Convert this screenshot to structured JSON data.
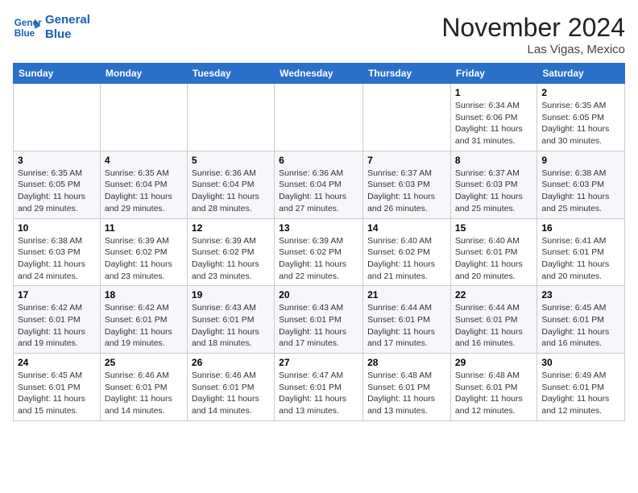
{
  "header": {
    "logo_line1": "General",
    "logo_line2": "Blue",
    "month_title": "November 2024",
    "location": "Las Vigas, Mexico"
  },
  "weekdays": [
    "Sunday",
    "Monday",
    "Tuesday",
    "Wednesday",
    "Thursday",
    "Friday",
    "Saturday"
  ],
  "weeks": [
    [
      {
        "day": "",
        "info": ""
      },
      {
        "day": "",
        "info": ""
      },
      {
        "day": "",
        "info": ""
      },
      {
        "day": "",
        "info": ""
      },
      {
        "day": "",
        "info": ""
      },
      {
        "day": "1",
        "info": "Sunrise: 6:34 AM\nSunset: 6:06 PM\nDaylight: 11 hours and 31 minutes."
      },
      {
        "day": "2",
        "info": "Sunrise: 6:35 AM\nSunset: 6:05 PM\nDaylight: 11 hours and 30 minutes."
      }
    ],
    [
      {
        "day": "3",
        "info": "Sunrise: 6:35 AM\nSunset: 6:05 PM\nDaylight: 11 hours and 29 minutes."
      },
      {
        "day": "4",
        "info": "Sunrise: 6:35 AM\nSunset: 6:04 PM\nDaylight: 11 hours and 29 minutes."
      },
      {
        "day": "5",
        "info": "Sunrise: 6:36 AM\nSunset: 6:04 PM\nDaylight: 11 hours and 28 minutes."
      },
      {
        "day": "6",
        "info": "Sunrise: 6:36 AM\nSunset: 6:04 PM\nDaylight: 11 hours and 27 minutes."
      },
      {
        "day": "7",
        "info": "Sunrise: 6:37 AM\nSunset: 6:03 PM\nDaylight: 11 hours and 26 minutes."
      },
      {
        "day": "8",
        "info": "Sunrise: 6:37 AM\nSunset: 6:03 PM\nDaylight: 11 hours and 25 minutes."
      },
      {
        "day": "9",
        "info": "Sunrise: 6:38 AM\nSunset: 6:03 PM\nDaylight: 11 hours and 25 minutes."
      }
    ],
    [
      {
        "day": "10",
        "info": "Sunrise: 6:38 AM\nSunset: 6:03 PM\nDaylight: 11 hours and 24 minutes."
      },
      {
        "day": "11",
        "info": "Sunrise: 6:39 AM\nSunset: 6:02 PM\nDaylight: 11 hours and 23 minutes."
      },
      {
        "day": "12",
        "info": "Sunrise: 6:39 AM\nSunset: 6:02 PM\nDaylight: 11 hours and 23 minutes."
      },
      {
        "day": "13",
        "info": "Sunrise: 6:39 AM\nSunset: 6:02 PM\nDaylight: 11 hours and 22 minutes."
      },
      {
        "day": "14",
        "info": "Sunrise: 6:40 AM\nSunset: 6:02 PM\nDaylight: 11 hours and 21 minutes."
      },
      {
        "day": "15",
        "info": "Sunrise: 6:40 AM\nSunset: 6:01 PM\nDaylight: 11 hours and 20 minutes."
      },
      {
        "day": "16",
        "info": "Sunrise: 6:41 AM\nSunset: 6:01 PM\nDaylight: 11 hours and 20 minutes."
      }
    ],
    [
      {
        "day": "17",
        "info": "Sunrise: 6:42 AM\nSunset: 6:01 PM\nDaylight: 11 hours and 19 minutes."
      },
      {
        "day": "18",
        "info": "Sunrise: 6:42 AM\nSunset: 6:01 PM\nDaylight: 11 hours and 19 minutes."
      },
      {
        "day": "19",
        "info": "Sunrise: 6:43 AM\nSunset: 6:01 PM\nDaylight: 11 hours and 18 minutes."
      },
      {
        "day": "20",
        "info": "Sunrise: 6:43 AM\nSunset: 6:01 PM\nDaylight: 11 hours and 17 minutes."
      },
      {
        "day": "21",
        "info": "Sunrise: 6:44 AM\nSunset: 6:01 PM\nDaylight: 11 hours and 17 minutes."
      },
      {
        "day": "22",
        "info": "Sunrise: 6:44 AM\nSunset: 6:01 PM\nDaylight: 11 hours and 16 minutes."
      },
      {
        "day": "23",
        "info": "Sunrise: 6:45 AM\nSunset: 6:01 PM\nDaylight: 11 hours and 16 minutes."
      }
    ],
    [
      {
        "day": "24",
        "info": "Sunrise: 6:45 AM\nSunset: 6:01 PM\nDaylight: 11 hours and 15 minutes."
      },
      {
        "day": "25",
        "info": "Sunrise: 6:46 AM\nSunset: 6:01 PM\nDaylight: 11 hours and 14 minutes."
      },
      {
        "day": "26",
        "info": "Sunrise: 6:46 AM\nSunset: 6:01 PM\nDaylight: 11 hours and 14 minutes."
      },
      {
        "day": "27",
        "info": "Sunrise: 6:47 AM\nSunset: 6:01 PM\nDaylight: 11 hours and 13 minutes."
      },
      {
        "day": "28",
        "info": "Sunrise: 6:48 AM\nSunset: 6:01 PM\nDaylight: 11 hours and 13 minutes."
      },
      {
        "day": "29",
        "info": "Sunrise: 6:48 AM\nSunset: 6:01 PM\nDaylight: 11 hours and 12 minutes."
      },
      {
        "day": "30",
        "info": "Sunrise: 6:49 AM\nSunset: 6:01 PM\nDaylight: 11 hours and 12 minutes."
      }
    ]
  ]
}
